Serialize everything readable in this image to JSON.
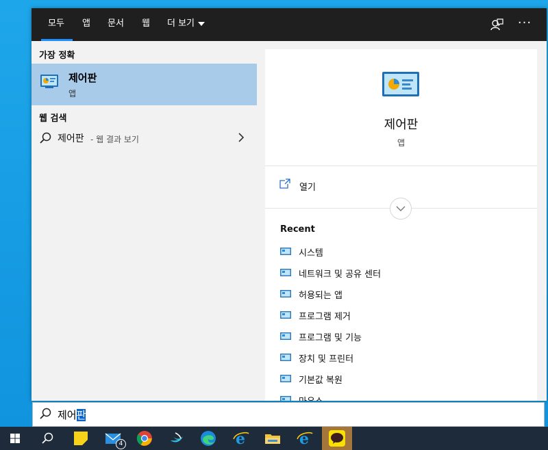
{
  "tabs": [
    {
      "label": "모두"
    },
    {
      "label": "앱"
    },
    {
      "label": "문서"
    },
    {
      "label": "웹"
    },
    {
      "label": "더 보기"
    }
  ],
  "left": {
    "best_match_label": "가장 정확",
    "best_match": {
      "title": "제어판",
      "subtitle": "앱"
    },
    "web_search_label": "웹 검색",
    "web_search": {
      "term": "제어판",
      "suffix": "- 웹 결과 보기"
    }
  },
  "right": {
    "app_title": "제어판",
    "app_subtitle": "앱",
    "open_label": "열기",
    "recent_label": "Recent",
    "recent_items": [
      "시스템",
      "네트워크 및 공유 센터",
      "허용되는 앱",
      "프로그램 제거",
      "프로그램 및 기능",
      "장치 및 프린터",
      "기본값 복원",
      "마우스"
    ]
  },
  "search": {
    "typed": "제어",
    "selected": "판"
  },
  "taskbar": {
    "mail_badge": "4",
    "items": [
      "windows-start-icon",
      "search-icon",
      "sticky-notes-icon",
      "mail-icon",
      "chrome-icon",
      "swift-icon",
      "edge-icon",
      "ie-icon",
      "file-explorer-icon",
      "ie-icon",
      "kakaotalk-icon"
    ]
  },
  "colors": {
    "accent": "#1e90ff",
    "selected_bg": "#a9cbea",
    "topbar": "#1f1f1f",
    "taskbar": "#1e2b3a",
    "desktop": "#1aa3e8"
  }
}
